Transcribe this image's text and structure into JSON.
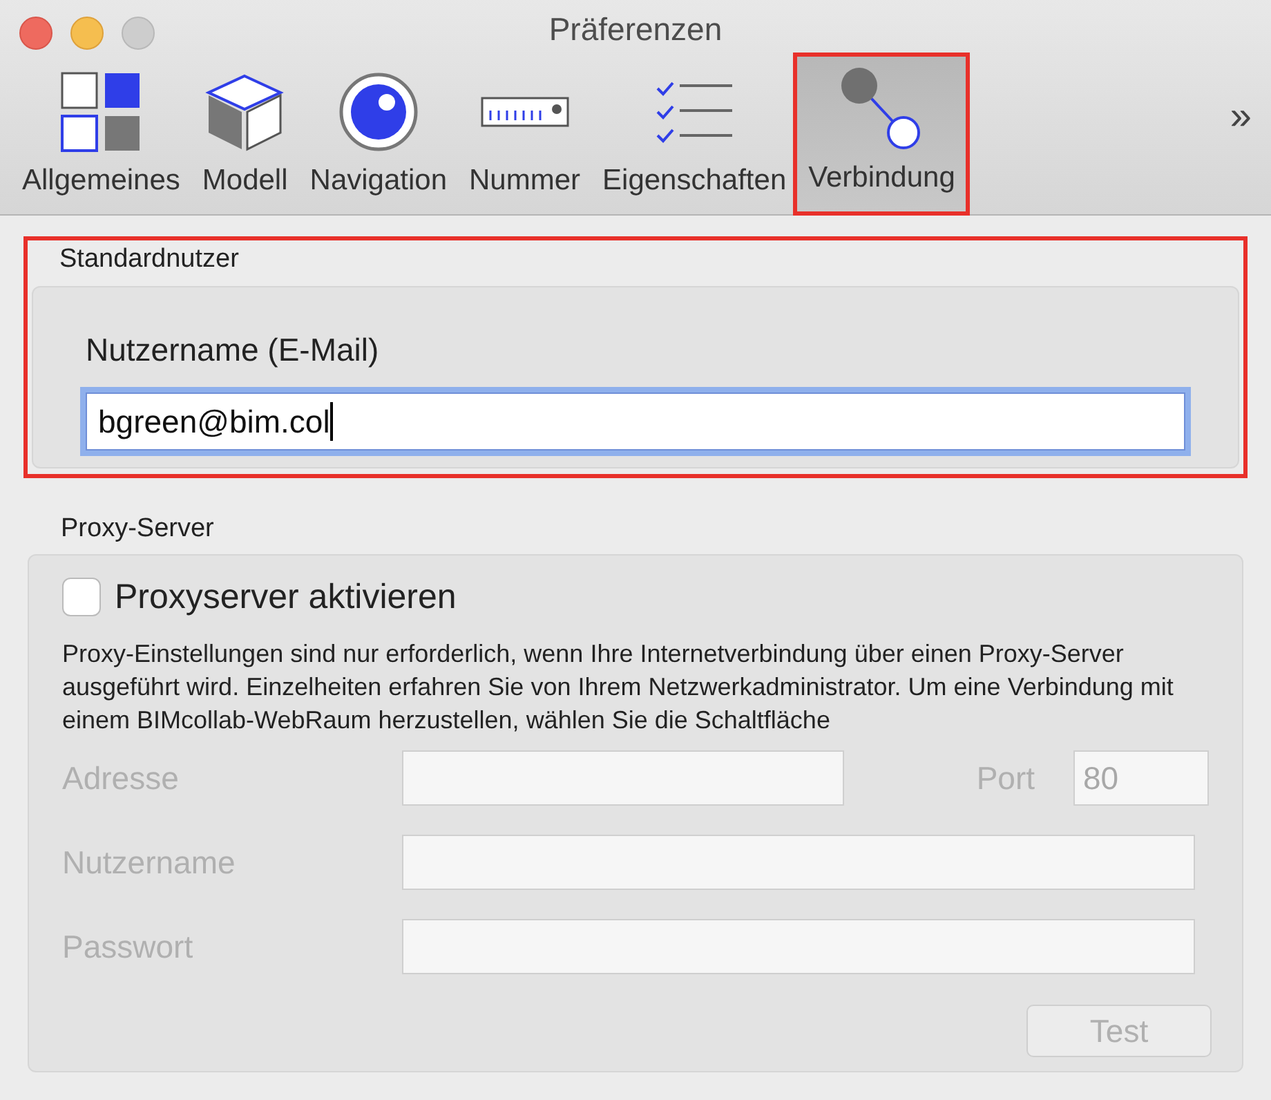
{
  "window": {
    "title": "Präferenzen"
  },
  "tabs": [
    {
      "label": "Allgemeines",
      "kind": "grid",
      "selected": false,
      "highlighted": false
    },
    {
      "label": "Modell",
      "kind": "cube",
      "selected": false,
      "highlighted": false
    },
    {
      "label": "Navigation",
      "kind": "eye",
      "selected": false,
      "highlighted": false
    },
    {
      "label": "Nummer",
      "kind": "ruler",
      "selected": false,
      "highlighted": false
    },
    {
      "label": "Eigenschaften",
      "kind": "checklist",
      "selected": false,
      "highlighted": false
    },
    {
      "label": "Verbindung",
      "kind": "link",
      "selected": true,
      "highlighted": true
    }
  ],
  "toolbar_overflow": "»",
  "default_user": {
    "heading": "Standardnutzer",
    "highlighted": true,
    "label": "Nutzername (E-Mail)",
    "value": "bgreen@bim.col",
    "focused": true
  },
  "proxy": {
    "heading": "Proxy-Server",
    "checkbox": {
      "label": "Proxyserver aktivieren",
      "checked": false
    },
    "description": "Proxy-Einstellungen sind nur erforderlich, wenn Ihre Internetverbindung über einen Proxy-Server ausgeführt wird. Einzelheiten erfahren Sie von Ihrem Netzwerkadministrator. Um eine Verbindung mit einem BIMcollab-WebRaum herzustellen, wählen Sie die Schaltfläche",
    "disabled": true,
    "fields": [
      {
        "label": "Adresse",
        "port_label": "Port",
        "port_value": "80"
      },
      {
        "label": "Nutzername"
      },
      {
        "label": "Passwort"
      }
    ],
    "button": "Test"
  }
}
